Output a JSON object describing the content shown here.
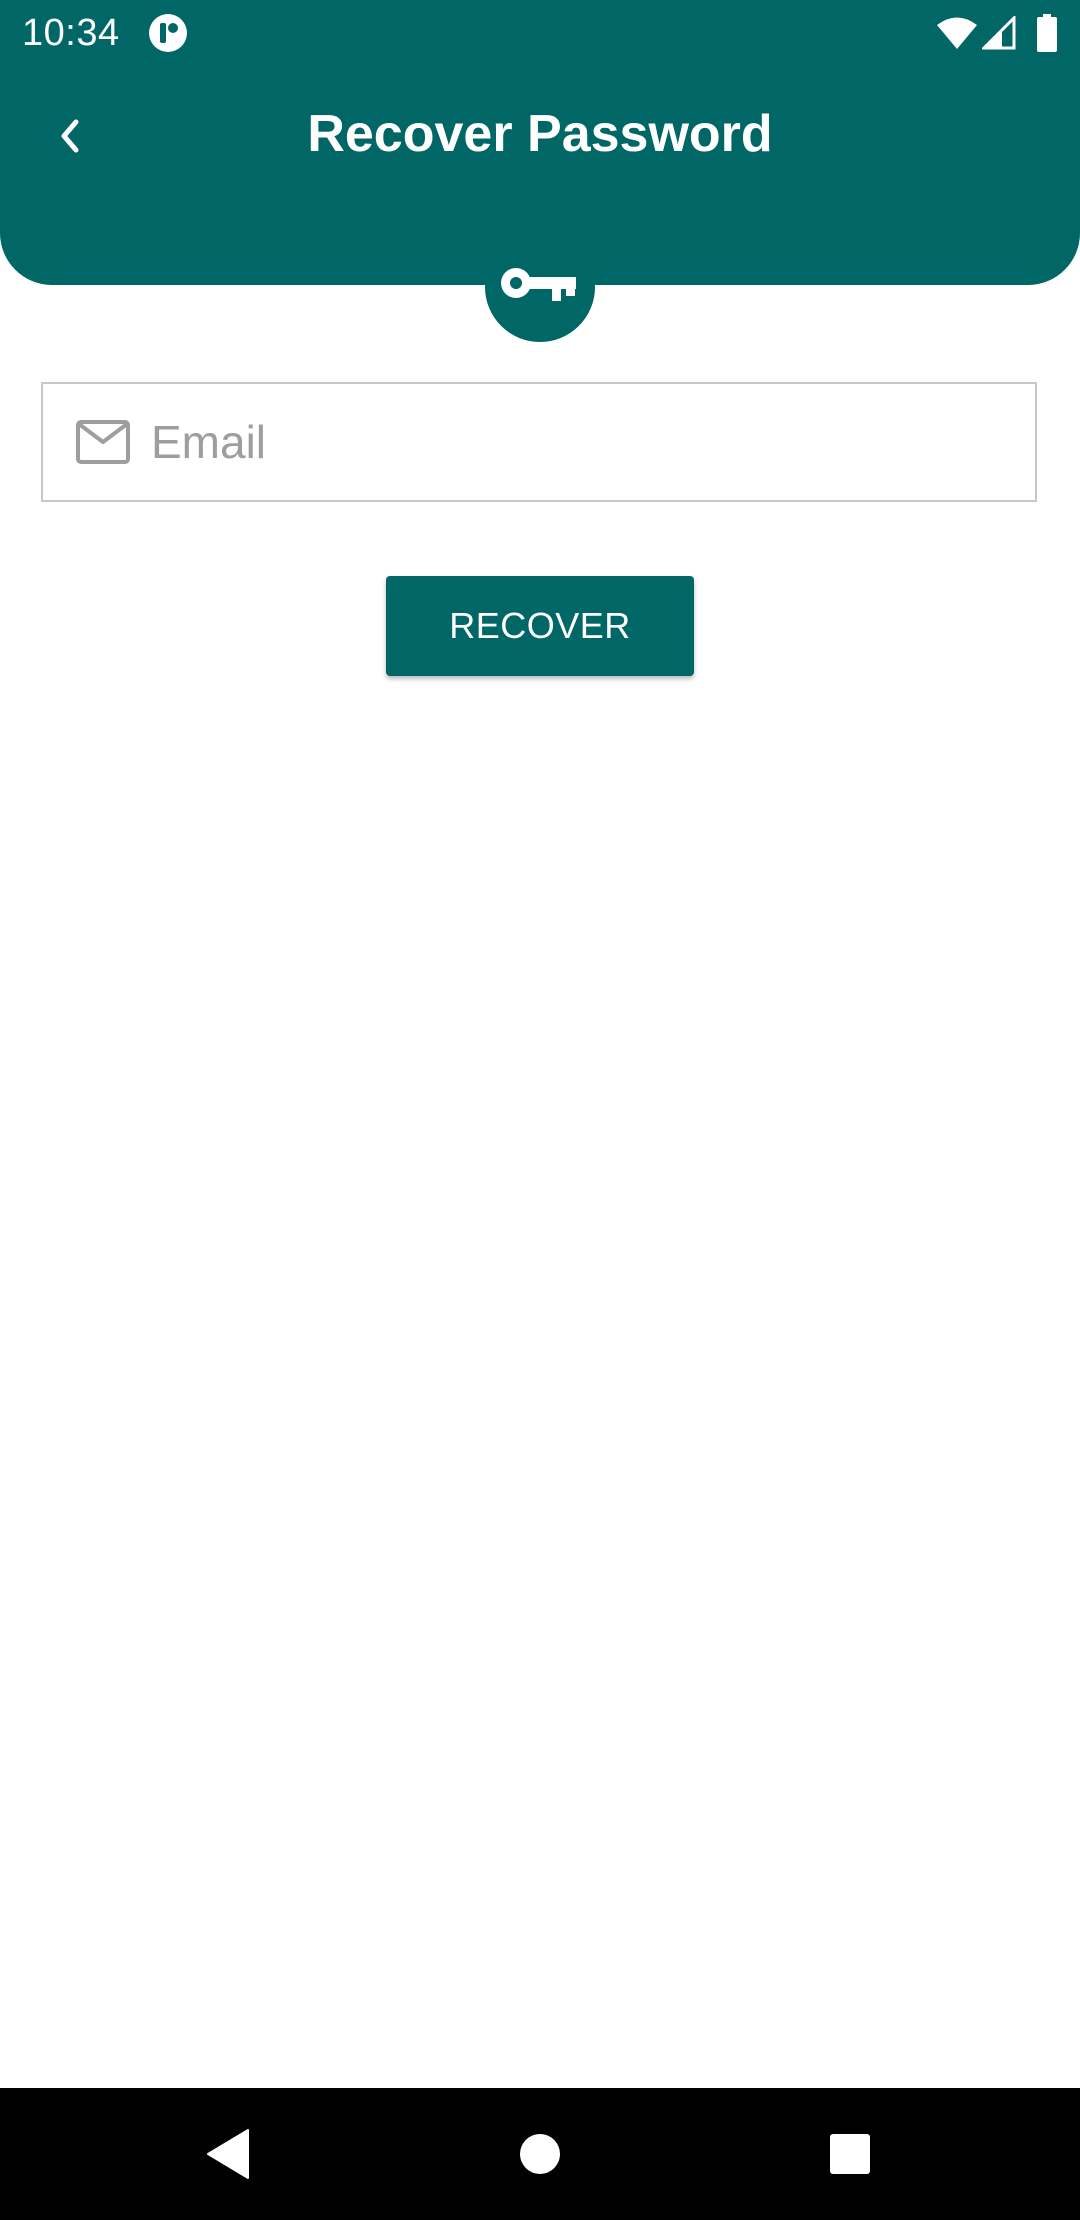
{
  "status_bar": {
    "time": "10:34",
    "icons": [
      "app-notification-icon",
      "wifi-icon",
      "signal-icon",
      "battery-icon"
    ]
  },
  "header": {
    "title": "Recover Password",
    "back_icon": "chevron-left-icon",
    "badge_icon": "key-icon"
  },
  "form": {
    "email": {
      "placeholder": "Email",
      "value": "",
      "icon": "mail-icon"
    },
    "recover_label": "RECOVER"
  },
  "nav_bar": {
    "icons": [
      "back-triangle-icon",
      "home-circle-icon",
      "recents-square-icon"
    ]
  },
  "colors": {
    "primary": "#006666",
    "background": "#ffffff",
    "placeholder": "#9e9e9e",
    "field_border": "#c8c8c8",
    "nav_bar": "#000000",
    "nav_icon": "#ffffff"
  }
}
